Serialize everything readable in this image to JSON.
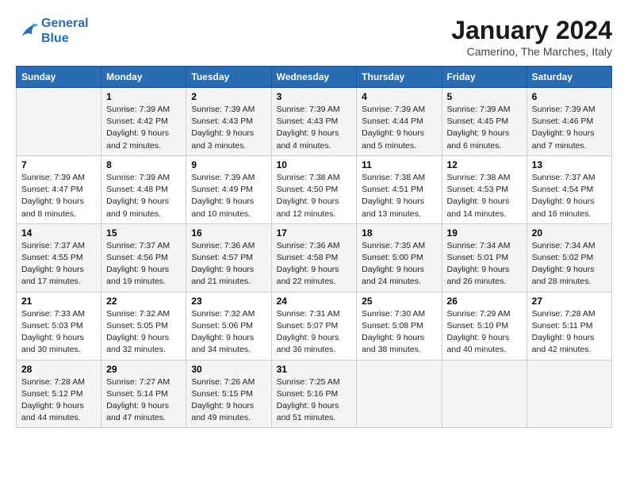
{
  "header": {
    "logo_line1": "General",
    "logo_line2": "Blue",
    "month_title": "January 2024",
    "location": "Camerino, The Marches, Italy"
  },
  "weekdays": [
    "Sunday",
    "Monday",
    "Tuesday",
    "Wednesday",
    "Thursday",
    "Friday",
    "Saturday"
  ],
  "weeks": [
    [
      {
        "day": "",
        "sunrise": "",
        "sunset": "",
        "daylight": ""
      },
      {
        "day": "1",
        "sunrise": "Sunrise: 7:39 AM",
        "sunset": "Sunset: 4:42 PM",
        "daylight": "Daylight: 9 hours and 2 minutes."
      },
      {
        "day": "2",
        "sunrise": "Sunrise: 7:39 AM",
        "sunset": "Sunset: 4:43 PM",
        "daylight": "Daylight: 9 hours and 3 minutes."
      },
      {
        "day": "3",
        "sunrise": "Sunrise: 7:39 AM",
        "sunset": "Sunset: 4:43 PM",
        "daylight": "Daylight: 9 hours and 4 minutes."
      },
      {
        "day": "4",
        "sunrise": "Sunrise: 7:39 AM",
        "sunset": "Sunset: 4:44 PM",
        "daylight": "Daylight: 9 hours and 5 minutes."
      },
      {
        "day": "5",
        "sunrise": "Sunrise: 7:39 AM",
        "sunset": "Sunset: 4:45 PM",
        "daylight": "Daylight: 9 hours and 6 minutes."
      },
      {
        "day": "6",
        "sunrise": "Sunrise: 7:39 AM",
        "sunset": "Sunset: 4:46 PM",
        "daylight": "Daylight: 9 hours and 7 minutes."
      }
    ],
    [
      {
        "day": "7",
        "sunrise": "Sunrise: 7:39 AM",
        "sunset": "Sunset: 4:47 PM",
        "daylight": "Daylight: 9 hours and 8 minutes."
      },
      {
        "day": "8",
        "sunrise": "Sunrise: 7:39 AM",
        "sunset": "Sunset: 4:48 PM",
        "daylight": "Daylight: 9 hours and 9 minutes."
      },
      {
        "day": "9",
        "sunrise": "Sunrise: 7:39 AM",
        "sunset": "Sunset: 4:49 PM",
        "daylight": "Daylight: 9 hours and 10 minutes."
      },
      {
        "day": "10",
        "sunrise": "Sunrise: 7:38 AM",
        "sunset": "Sunset: 4:50 PM",
        "daylight": "Daylight: 9 hours and 12 minutes."
      },
      {
        "day": "11",
        "sunrise": "Sunrise: 7:38 AM",
        "sunset": "Sunset: 4:51 PM",
        "daylight": "Daylight: 9 hours and 13 minutes."
      },
      {
        "day": "12",
        "sunrise": "Sunrise: 7:38 AM",
        "sunset": "Sunset: 4:53 PM",
        "daylight": "Daylight: 9 hours and 14 minutes."
      },
      {
        "day": "13",
        "sunrise": "Sunrise: 7:37 AM",
        "sunset": "Sunset: 4:54 PM",
        "daylight": "Daylight: 9 hours and 16 minutes."
      }
    ],
    [
      {
        "day": "14",
        "sunrise": "Sunrise: 7:37 AM",
        "sunset": "Sunset: 4:55 PM",
        "daylight": "Daylight: 9 hours and 17 minutes."
      },
      {
        "day": "15",
        "sunrise": "Sunrise: 7:37 AM",
        "sunset": "Sunset: 4:56 PM",
        "daylight": "Daylight: 9 hours and 19 minutes."
      },
      {
        "day": "16",
        "sunrise": "Sunrise: 7:36 AM",
        "sunset": "Sunset: 4:57 PM",
        "daylight": "Daylight: 9 hours and 21 minutes."
      },
      {
        "day": "17",
        "sunrise": "Sunrise: 7:36 AM",
        "sunset": "Sunset: 4:58 PM",
        "daylight": "Daylight: 9 hours and 22 minutes."
      },
      {
        "day": "18",
        "sunrise": "Sunrise: 7:35 AM",
        "sunset": "Sunset: 5:00 PM",
        "daylight": "Daylight: 9 hours and 24 minutes."
      },
      {
        "day": "19",
        "sunrise": "Sunrise: 7:34 AM",
        "sunset": "Sunset: 5:01 PM",
        "daylight": "Daylight: 9 hours and 26 minutes."
      },
      {
        "day": "20",
        "sunrise": "Sunrise: 7:34 AM",
        "sunset": "Sunset: 5:02 PM",
        "daylight": "Daylight: 9 hours and 28 minutes."
      }
    ],
    [
      {
        "day": "21",
        "sunrise": "Sunrise: 7:33 AM",
        "sunset": "Sunset: 5:03 PM",
        "daylight": "Daylight: 9 hours and 30 minutes."
      },
      {
        "day": "22",
        "sunrise": "Sunrise: 7:32 AM",
        "sunset": "Sunset: 5:05 PM",
        "daylight": "Daylight: 9 hours and 32 minutes."
      },
      {
        "day": "23",
        "sunrise": "Sunrise: 7:32 AM",
        "sunset": "Sunset: 5:06 PM",
        "daylight": "Daylight: 9 hours and 34 minutes."
      },
      {
        "day": "24",
        "sunrise": "Sunrise: 7:31 AM",
        "sunset": "Sunset: 5:07 PM",
        "daylight": "Daylight: 9 hours and 36 minutes."
      },
      {
        "day": "25",
        "sunrise": "Sunrise: 7:30 AM",
        "sunset": "Sunset: 5:08 PM",
        "daylight": "Daylight: 9 hours and 38 minutes."
      },
      {
        "day": "26",
        "sunrise": "Sunrise: 7:29 AM",
        "sunset": "Sunset: 5:10 PM",
        "daylight": "Daylight: 9 hours and 40 minutes."
      },
      {
        "day": "27",
        "sunrise": "Sunrise: 7:28 AM",
        "sunset": "Sunset: 5:11 PM",
        "daylight": "Daylight: 9 hours and 42 minutes."
      }
    ],
    [
      {
        "day": "28",
        "sunrise": "Sunrise: 7:28 AM",
        "sunset": "Sunset: 5:12 PM",
        "daylight": "Daylight: 9 hours and 44 minutes."
      },
      {
        "day": "29",
        "sunrise": "Sunrise: 7:27 AM",
        "sunset": "Sunset: 5:14 PM",
        "daylight": "Daylight: 9 hours and 47 minutes."
      },
      {
        "day": "30",
        "sunrise": "Sunrise: 7:26 AM",
        "sunset": "Sunset: 5:15 PM",
        "daylight": "Daylight: 9 hours and 49 minutes."
      },
      {
        "day": "31",
        "sunrise": "Sunrise: 7:25 AM",
        "sunset": "Sunset: 5:16 PM",
        "daylight": "Daylight: 9 hours and 51 minutes."
      },
      {
        "day": "",
        "sunrise": "",
        "sunset": "",
        "daylight": ""
      },
      {
        "day": "",
        "sunrise": "",
        "sunset": "",
        "daylight": ""
      },
      {
        "day": "",
        "sunrise": "",
        "sunset": "",
        "daylight": ""
      }
    ]
  ]
}
